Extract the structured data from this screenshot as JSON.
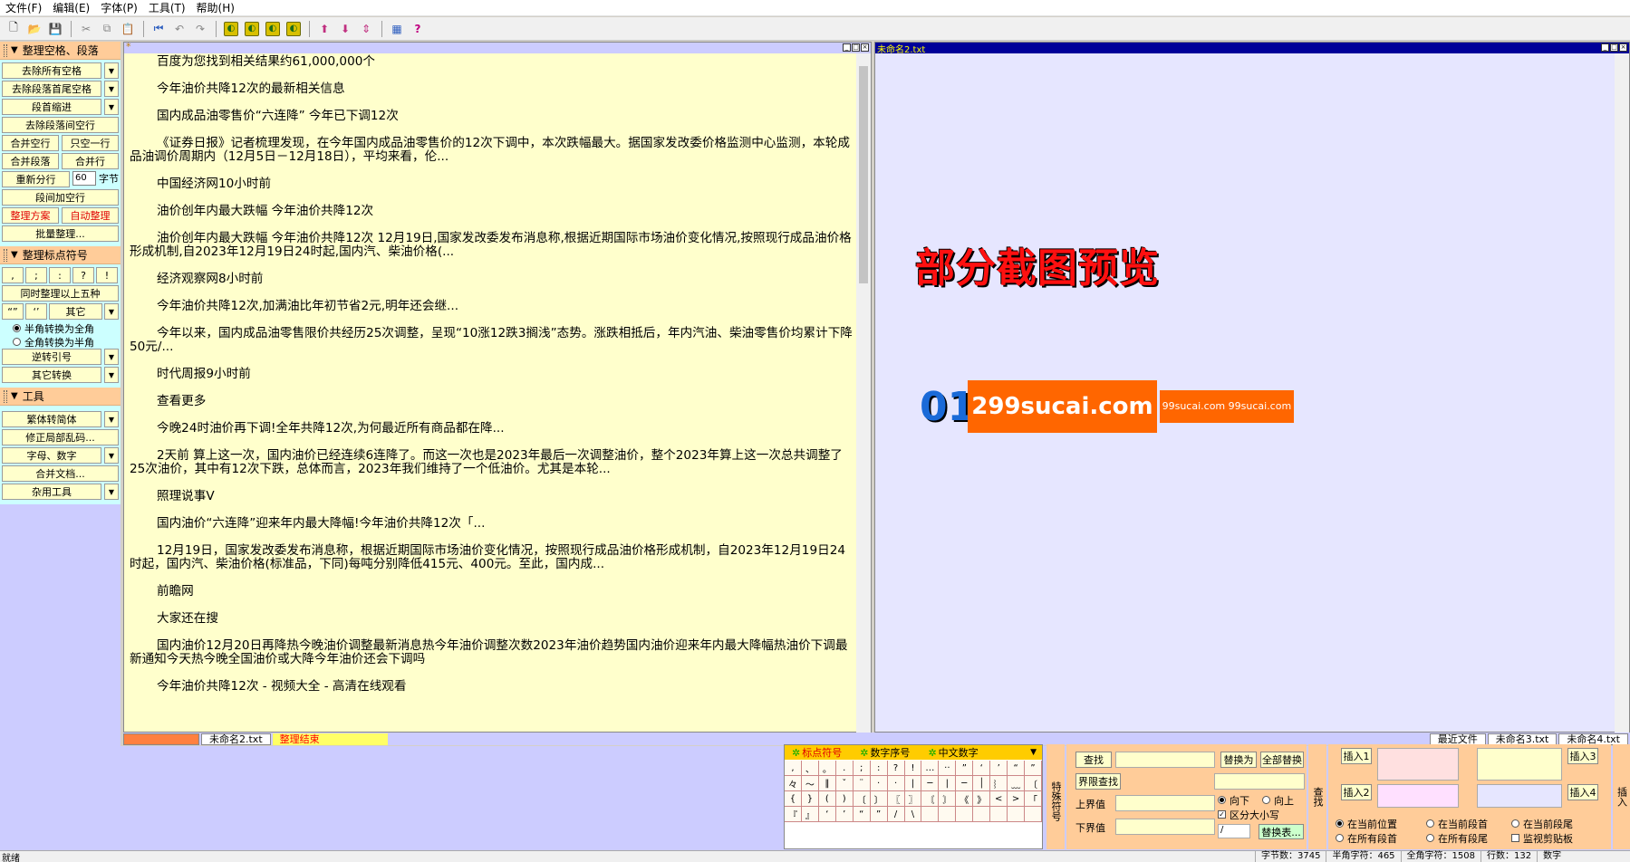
{
  "menu": [
    "文件(F)",
    "编辑(E)",
    "字体(P)",
    "工具(T)",
    "帮助(H)"
  ],
  "toolbar": {
    "file_icons": [
      "new-file-icon",
      "open-folder-icon",
      "save-icon"
    ],
    "edit_icons": [
      "cut-icon",
      "copy-icon",
      "paste-icon"
    ],
    "nav_icons": [
      "goto-start-icon",
      "undo-icon",
      "redo-icon"
    ],
    "action_icons": [
      "action-1-icon",
      "action-2-icon",
      "action-3-icon",
      "action-4-icon"
    ],
    "move_icons": [
      "move-up-icon",
      "move-down-icon",
      "move-updown-icon"
    ],
    "misc_icons": [
      "screen-icon",
      "help-icon"
    ]
  },
  "left": {
    "sec1_title": "整理空格、段落",
    "remove_all_spaces": "去除所有空格",
    "remove_head_tail": "去除段落首尾空格",
    "indent_first": "段首缩进",
    "remove_between": "去除段落间空行",
    "merge_blank": "合并空行",
    "one_blank": "只空一行",
    "merge_para": "合并段落",
    "merge_line": "合并行",
    "re_split": "重新分行",
    "split_num": "60",
    "split_unit": "字节",
    "add_blank": "段间加空行",
    "scheme": "整理方案",
    "auto_clean": "自动整理",
    "batch_clean": "批量整理...",
    "sec2_title": "整理标点符号",
    "punct_btns": [
      ",",
      ";",
      ":",
      "?",
      "!"
    ],
    "clean_five": "同时整理以上五种",
    "quote1": "“”",
    "quote2": "‘’",
    "other": "其它",
    "half_to_full": "半角转换为全角",
    "full_to_half": "全角转换为半角",
    "reverse_quote": "逆转引号",
    "other_convert": "其它转换",
    "sec3_title": "工具",
    "trad_simp": "繁体转简体",
    "fix_garble": "修正局部乱码...",
    "letters_digits": "字母、数字",
    "merge_docs": "合并文档...",
    "misc_tools": "杂用工具"
  },
  "editor1": {
    "paragraphs": [
      "百度为您找到相关结果约61,000,000个",
      "今年油价共降12次的最新相关信息",
      "国内成品油零售价“六连降” 今年已下调12次",
      "《证券日报》记者梳理发现，在今年国内成品油零售价的12次下调中，本次跌幅最大。据国家发改委价格监测中心监测，本轮成品油调价周期内（12月5日－12月18日），平均来看，伦...",
      "中国经济网10小时前",
      "油价创年内最大跌幅 今年油价共降12次",
      "油价创年内最大跌幅 今年油价共降12次 12月19日,国家发改委发布消息称,根据近期国际市场油价变化情况,按照现行成品油价格形成机制,自2023年12月19日24时起,国内汽、柴油价格(...",
      "经济观察网8小时前",
      "今年油价共降12次,加满油比年初节省2元,明年还会继...",
      "今年以来，国内成品油零售限价共经历25次调整，呈现“10涨12跌3搁浅”态势。涨跌相抵后，年内汽油、柴油零售价均累计下降50元/...",
      "时代周报9小时前",
      "查看更多",
      "今晚24时油价再下调!全年共降12次,为何最近所有商品都在降...",
      "2天前 算上这一次，国内油价已经连续6连降了。而这一次也是2023年最后一次调整油价，整个2023年算上这一次总共调整了25次油价，其中有12次下跌，总体而言，2023年我们维持了一个低油价。尤其是本轮...",
      "照理说事V",
      "国内油价“六连降”迎来年内最大降幅!今年油价共降12次「...",
      "12月19日，国家发改委发布消息称，根据近期国际市场油价变化情况，按照现行成品油价格形成机制，自2023年12月19日24时起，国内汽、柴油价格(标准品，下同)每吨分别降低415元、400元。至此，国内成...",
      "前瞻网",
      "大家还在搜",
      "国内油价12月20日再降热今晚油价调整最新消息热今年油价调整次数2023年油价趋势国内油价迎来年内最大降幅热油价下调最新通知今天热今晚全国油价或大降今年油价还会下调吗",
      "今年油价共降12次 - 视频大全 - 高清在线观看"
    ]
  },
  "editor2": {
    "title": "未命名2.txt"
  },
  "stamp": {
    "preview": "部分截图预览",
    "big01": "01",
    "url1": "299sucai.com",
    "url2": "99sucai.com 99sucai.com"
  },
  "tabs": {
    "left": [
      "未命名2.txt"
    ],
    "status_tab": "整理结束",
    "right": [
      "最近文件",
      "未命名3.txt",
      "未命名4.txt"
    ]
  },
  "punct": {
    "tabs": [
      "标点符号",
      "数字序号",
      "中文数字"
    ],
    "chars": [
      ",",
      "、",
      "。",
      ".",
      ";",
      ":",
      "?",
      "!",
      "…",
      "··",
      "”",
      "‘",
      "’",
      "“",
      "”",
      "々",
      "～",
      "‖",
      "ˇ",
      "¨",
      "·",
      "·",
      "|",
      "─",
      "|",
      "─",
      "│",
      "︴",
      "﹏",
      "〔",
      "{",
      "}",
      "(",
      ")",
      "〔",
      "〕",
      "〖",
      "〗",
      "〘",
      "〙",
      "《",
      "》",
      "<",
      ">",
      "「",
      "『",
      "』",
      "‘",
      "’",
      "“",
      "”",
      "/",
      "\\",
      "",
      "",
      "",
      "",
      "",
      "",
      ""
    ]
  },
  "special_label": "特殊符号",
  "search": {
    "find": "查找",
    "replace_with": "替换为",
    "replace_all": "全部替换",
    "range_find": "界限查找",
    "upper": "上界值",
    "lower": "下界值",
    "down": "向下",
    "up": "向上",
    "case": "区分大小写",
    "sep": "/",
    "replace_table": "替换表..."
  },
  "find_label": "查找",
  "insert": {
    "ins1": "插入1",
    "ins2": "插入2",
    "ins3": "插入3",
    "ins4": "插入4",
    "at_cursor": "在当前位置",
    "at_para_head": "在当前段首",
    "at_para_tail": "在当前段尾",
    "all_para_head": "在所有段首",
    "all_para_tail": "在所有段尾",
    "monitor_clip": "监视剪贴板"
  },
  "insert_label": "插入",
  "status": {
    "left": "就绪",
    "bytes": "字节数：3745",
    "half": "半角字符：465",
    "full": "全角字符：1508",
    "lines": "行数：132",
    "mode": "数字"
  },
  "colors": {
    "panel_bg": "#ccccff",
    "section_header": "#ffcc99",
    "button_bg": "#ffffcc",
    "editor_bg": "#ffffcc",
    "editor2_bg": "#e6e6ff",
    "active_title": "#000099"
  }
}
